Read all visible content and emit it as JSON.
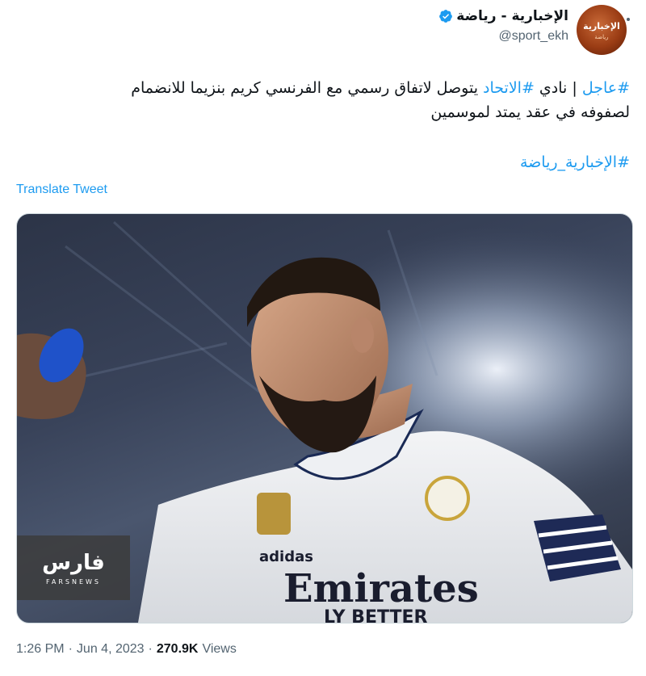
{
  "author": {
    "display_name": "الإخبارية - رياضة",
    "handle": "@sport_ekh",
    "avatar_text": "الإخبارية",
    "avatar_subtext": "رياضة",
    "verified": true
  },
  "tweet": {
    "hashtag_1": "#عاجل",
    "separator": " | نادي ",
    "hashtag_2": "#الاتحاد",
    "text_line1": " يتوصل لاتفاق رسمي مع الفرنسي كريم بنزيما للانضمام",
    "text_line2": "لصفوفه في عقد يمتد لموسمين",
    "hashtag_3": "#الإخبارية_رياضة",
    "translate_label": "Translate Tweet"
  },
  "media": {
    "shirt_sponsor": "Emirates",
    "shirt_sponsor_2": "LY BETTER",
    "brand": "adidas",
    "watermark_text": "فارس",
    "watermark_sub": "FARSNEWS"
  },
  "meta": {
    "time": "1:26 PM",
    "dot1": "·",
    "date": "Jun 4, 2023",
    "dot2": "·",
    "views_count": "270.9K",
    "views_label": "Views"
  },
  "colors": {
    "link": "#1d9bf0",
    "muted": "#536471",
    "text": "#0f1419"
  }
}
